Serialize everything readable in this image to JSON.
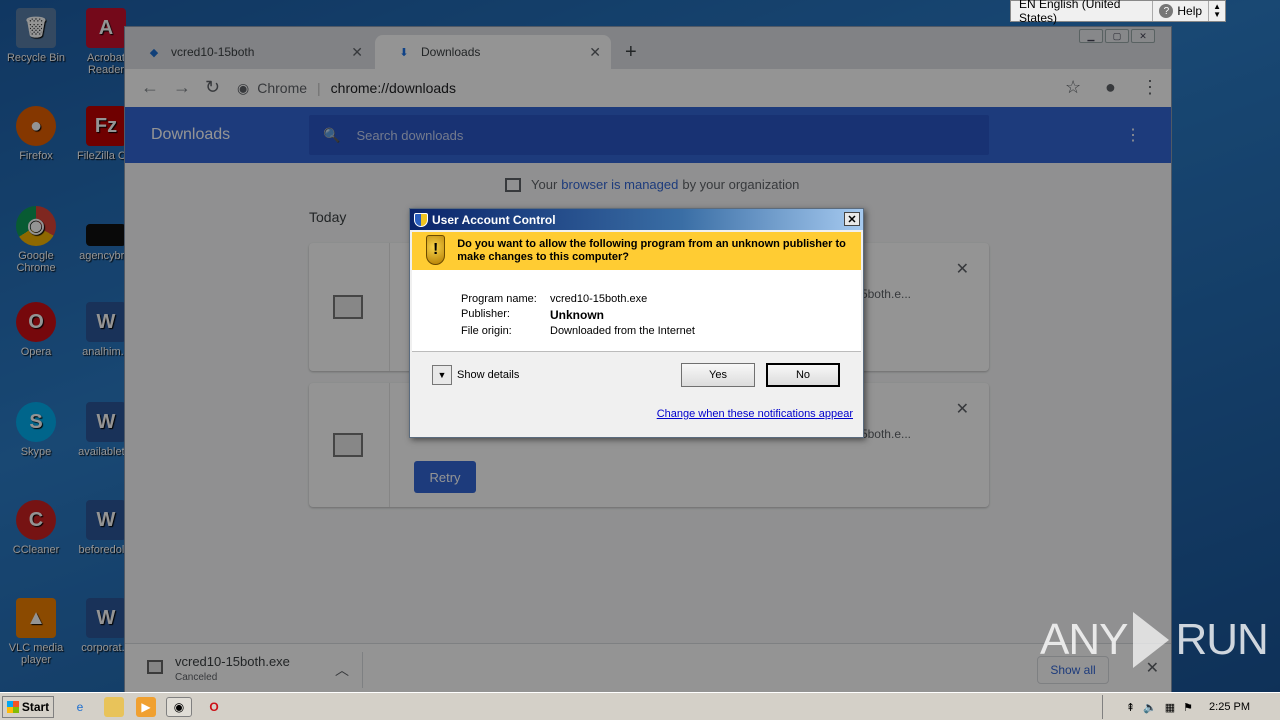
{
  "desktop": {
    "icons": [
      {
        "label": "Recycle Bin",
        "color": "#5a7fa8",
        "glyph": "🗑"
      },
      {
        "label": "Acrobat Reader",
        "color": "#c8102e",
        "glyph": "A"
      },
      {
        "label": "Firefox",
        "color": "#e66000",
        "glyph": "●"
      },
      {
        "label": "FileZilla C...",
        "color": "#bf0000",
        "glyph": "Fz"
      },
      {
        "label": "Google Chrome",
        "color": "#4285f4",
        "glyph": "◉"
      },
      {
        "label": "agencybr...",
        "color": "#111111",
        "glyph": ""
      },
      {
        "label": "Opera",
        "color": "#cc0f16",
        "glyph": "O"
      },
      {
        "label": "analhim...",
        "color": "#2b579a",
        "glyph": "W"
      },
      {
        "label": "Skype",
        "color": "#00aff0",
        "glyph": "S"
      },
      {
        "label": "availablet...",
        "color": "#2b579a",
        "glyph": "W"
      },
      {
        "label": "CCleaner",
        "color": "#cc2222",
        "glyph": "C"
      },
      {
        "label": "beforedol...",
        "color": "#2b579a",
        "glyph": "W"
      },
      {
        "label": "VLC media player",
        "color": "#f08000",
        "glyph": "▲"
      },
      {
        "label": "corporat...",
        "color": "#2b579a",
        "glyph": "W"
      }
    ]
  },
  "chrome": {
    "tabs": [
      {
        "label": "vcred10-15both",
        "close": "✕",
        "icon": "edge-like-icon"
      },
      {
        "label": "Downloads",
        "close": "✕",
        "icon": "download-icon"
      }
    ],
    "new_tab": "+",
    "omnibox": {
      "site": "Chrome",
      "url": "chrome://downloads"
    },
    "downloads": {
      "title": "Downloads",
      "search_placeholder": "Search downloads",
      "managed_pre": "Your",
      "managed_link": "browser is managed",
      "managed_post": "by your organization",
      "section": "Today",
      "card1_name": "5both.e...",
      "card2_name": "5both.e...",
      "retry": "Retry"
    },
    "shelf": {
      "file": "vcred10-15both.exe",
      "status": "Canceled",
      "show_all": "Show all"
    }
  },
  "langbar": {
    "language": "EN English (United States)",
    "help": "Help"
  },
  "uac": {
    "title": "User Account Control",
    "question": "Do you want to allow the following program from an unknown publisher to make changes to this computer?",
    "program_name_label": "Program name:",
    "program_name": "vcred10-15both.exe",
    "publisher_label": "Publisher:",
    "publisher": "Unknown",
    "file_origin_label": "File origin:",
    "file_origin": "Downloaded from the Internet",
    "show_details": "Show details",
    "yes": "Yes",
    "no": "No",
    "link": "Change when these notifications appear"
  },
  "taskbar": {
    "start": "Start",
    "time": "2:25 PM"
  },
  "watermark": {
    "left": "ANY",
    "right": "RUN"
  }
}
